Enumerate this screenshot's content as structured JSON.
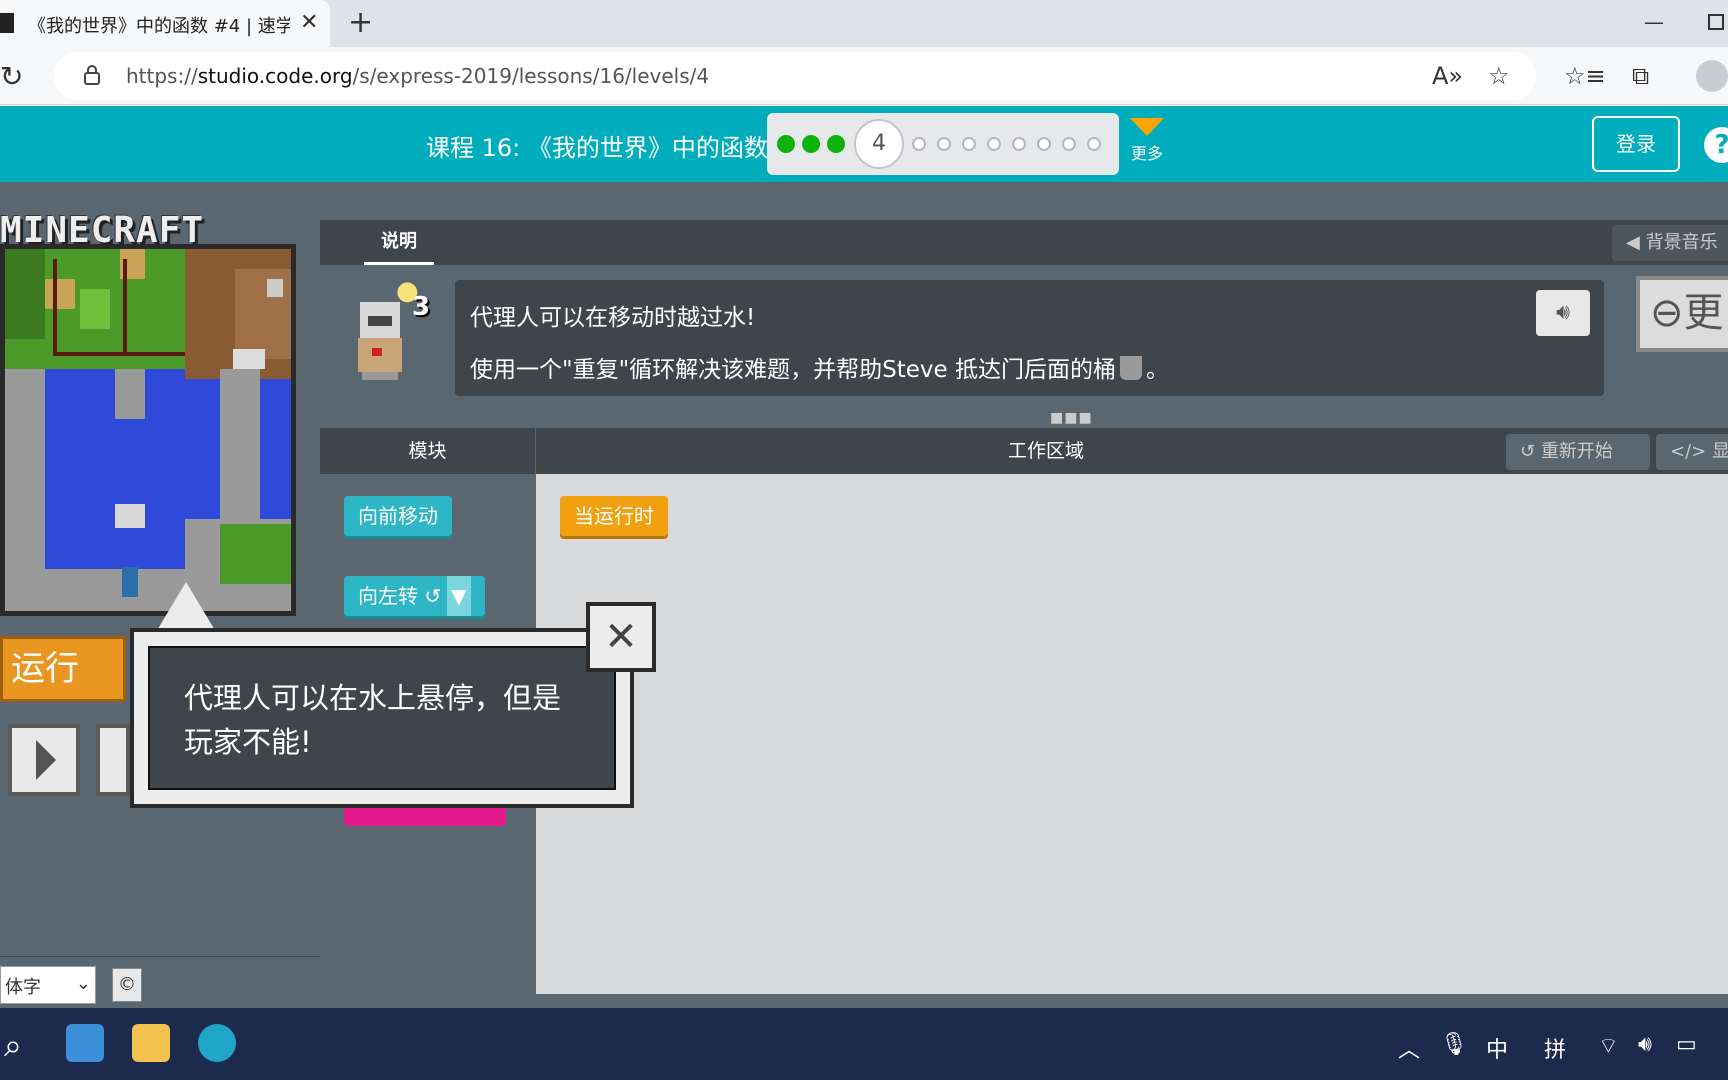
{
  "browser": {
    "tab_title": "《我的世界》中的函数 #4 | 速学",
    "url_prefix": "https://",
    "url_host": "studio.code.org",
    "url_path": "/s/express-2019/lessons/16/levels/4"
  },
  "header": {
    "lesson_title": "课程 16: 《我的世界》中的函数",
    "current_level": "4",
    "more_label": "更多",
    "login_label": "登录",
    "help_label": "?"
  },
  "game": {
    "logo_text": "MINECRAFT",
    "run_label": "运行"
  },
  "instructions": {
    "tab_label": "说明",
    "bg_music_label": "背景音乐",
    "hint_count": "3",
    "line1": "代理人可以在移动时越过水!",
    "line2": "使用一个\"重复\"循环解决该难题，并帮助Steve 抵达门后面的桶",
    "line2_end": "。",
    "more_button_label": "更"
  },
  "workspace": {
    "toolbox_label": "模块",
    "workspace_label": "工作区域",
    "restart_label": "重新开始",
    "show_code_label": "显",
    "blocks": {
      "move_forward": "向前移动",
      "turn_left": "向左转 ↺",
      "when_run": "当运行时"
    }
  },
  "callout": {
    "text": "代理人可以在水上悬停，但是玩家不能!"
  },
  "footer": {
    "font_select_value": "体字",
    "copyright_symbol": "©"
  },
  "taskbar": {
    "ime_lang": "中",
    "ime_mode": "拼"
  }
}
